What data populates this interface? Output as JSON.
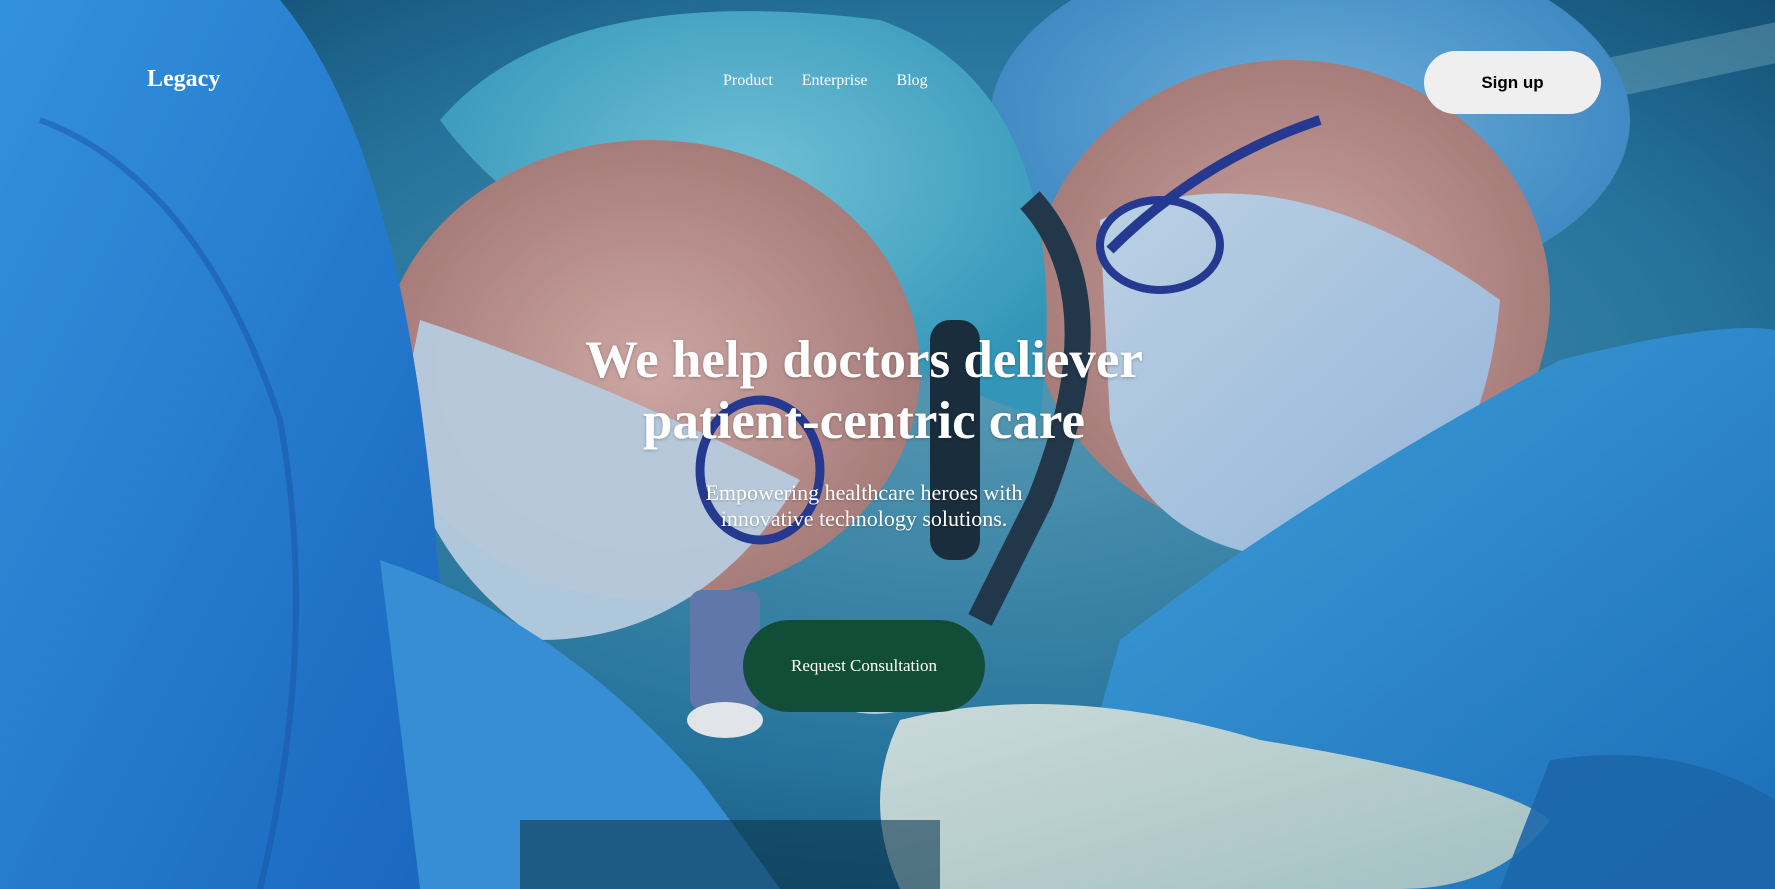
{
  "nav": {
    "logo": "Legacy",
    "links": [
      "Product",
      "Enterprise",
      "Blog"
    ],
    "signup_label": "Sign up"
  },
  "hero": {
    "title_line1": "We help doctors deliever",
    "title_line2": "patient-centric care",
    "subtitle_line1": "Empowering healthcare heroes with",
    "subtitle_line2": "innovative technology solutions.",
    "cta_label": "Request Consultation"
  },
  "colors": {
    "cta_background": "#124d37",
    "signup_background": "#efefef",
    "text": "#ffffff"
  },
  "icons": {
    "background": "surgeons-photo"
  }
}
